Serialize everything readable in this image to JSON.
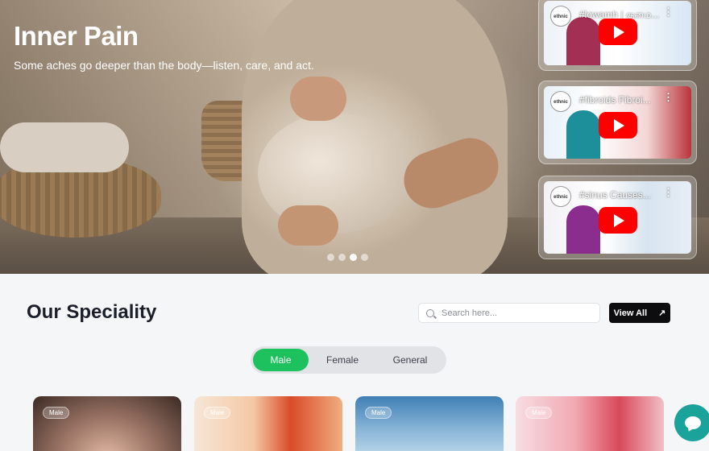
{
  "hero": {
    "title": "Inner Pain",
    "subtitle": "Some aches go deeper than the body—listen, care, and act.",
    "carousel_slide_count": 4,
    "carousel_active_index": 2
  },
  "videos": [
    {
      "title": "#lowamh | குமை...",
      "channel_logo": "ethnic",
      "icon": "youtube-play-icon"
    },
    {
      "title": "#fibroids Fibroi...",
      "channel_logo": "ethnic",
      "icon": "youtube-play-icon"
    },
    {
      "title": "#sinus Causes...",
      "channel_logo": "ethnic",
      "icon": "youtube-play-icon"
    }
  ],
  "speciality": {
    "title": "Our Speciality",
    "search_placeholder": "Search here...",
    "view_all_label": "View All",
    "tabs": [
      "Male",
      "Female",
      "General"
    ],
    "active_tab": "Male",
    "cards": [
      {
        "badge": "Male"
      },
      {
        "badge": "Male"
      },
      {
        "badge": "Male"
      },
      {
        "badge": "Male"
      }
    ]
  },
  "colors": {
    "accent_green": "#1dc25f",
    "chat_teal": "#1aa39a",
    "button_dark": "#0d0d10",
    "youtube_red": "#ff0000"
  }
}
